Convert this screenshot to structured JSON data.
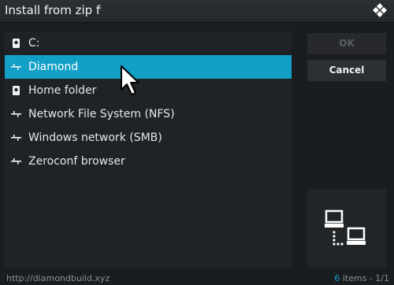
{
  "window": {
    "title": "Install from zip file"
  },
  "sources": [
    {
      "label": "C:",
      "icon": "hard-drive-icon",
      "selected": false
    },
    {
      "label": "Diamond",
      "icon": "network-share-icon",
      "selected": true
    },
    {
      "label": "Home folder",
      "icon": "hard-drive-icon",
      "selected": false
    },
    {
      "label": "Network File System (NFS)",
      "icon": "network-share-icon",
      "selected": false
    },
    {
      "label": "Windows network (SMB)",
      "icon": "network-share-icon",
      "selected": false
    },
    {
      "label": "Zeroconf browser",
      "icon": "network-share-icon",
      "selected": false
    }
  ],
  "buttons": {
    "ok_label": "OK",
    "cancel_label": "Cancel"
  },
  "footer": {
    "path": "http://diamondbuild.xyz",
    "item_count": "6",
    "item_suffix": " items - 1/1"
  },
  "colors": {
    "accent": "#12a0c7",
    "background": "#1a1d20"
  }
}
